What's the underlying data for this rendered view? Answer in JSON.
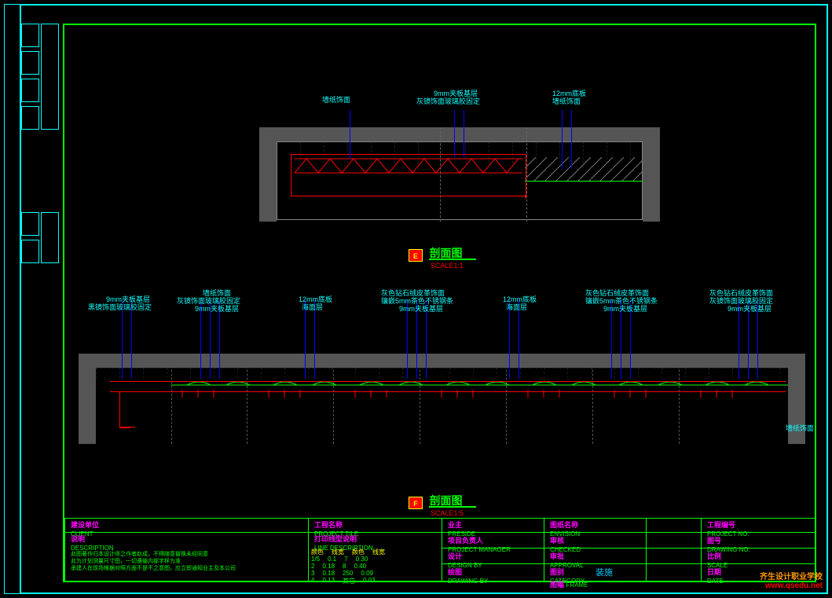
{
  "sectionE": {
    "marker": "E",
    "title": "剖面图",
    "scale": "SCALE1:1",
    "annotations": {
      "a1": "墙纸饰面",
      "a2_line1": "9mm夹板基层",
      "a2_line2": "灰镜饰面玻璃胶固定",
      "a3_line1": "12mm底板",
      "a3_line2": "墙纸饰面"
    }
  },
  "sectionF": {
    "marker": "F",
    "title": "剖面图",
    "scale": "SCALE1:5",
    "sideAnno": "墙纸饰面",
    "columns": [
      {
        "top1": "9mm夹板基层",
        "top2": "黑镜饰面玻璃胶固定"
      },
      {
        "top1": "墙纸饰面",
        "top2": "灰镜饰面玻璃胶固定",
        "top3": "9mm夹板基层"
      },
      {
        "top1": "12mm底板",
        "top2": "海面层"
      },
      {
        "top1": "灰色钻石绒皮革饰面",
        "top2": "镶嵌5mm茶色不锈钢条",
        "top3": "9mm夹板基层"
      },
      {
        "top1": "12mm底板",
        "top2": "海面层"
      },
      {
        "top1": "灰色钻石绒皮革饰面",
        "top2": "镶嵌5mm茶色不锈钢条",
        "top3": "9mm夹板基层"
      },
      {
        "top1": "灰色钻石绒皮革饰面",
        "top2": "灰镜饰面玻璃胶固定",
        "top3": "9mm夹板基层"
      }
    ]
  },
  "titleblock": {
    "client_label": "建设单位",
    "client_sub": "CLIENT",
    "desc_label": "说明",
    "desc_sub": "DESCRIPTION",
    "desc_text1": "此图著作归本设计师之作者赵成，不得随意替换未经同意",
    "desc_text2": "此为计划测量尺寸图，一切遵循内部字样为准",
    "desc_text3": "承建人在现场根据对照方面不是不之意图，应立即通知业主及本公司",
    "project_label": "工程名称",
    "project_sub": "PROJECT TILE",
    "line_label": "打印线型说明",
    "line_sub": "LINE DESCRIPTION",
    "line_head_col": "颜色",
    "line_head_wide": "线宽",
    "line_head_col2": "颜色",
    "line_head_wide2": "线宽",
    "line_rows": [
      {
        "c1": "1/5",
        "w1": "0.1",
        "c2": "7",
        "w2": "0.30"
      },
      {
        "c1": "2",
        "w1": "0.18",
        "c2": "8",
        "w2": "0.40"
      },
      {
        "c1": "3",
        "w1": "0.18",
        "c2": "250",
        "w2": "0.09"
      },
      {
        "c1": "4",
        "w1": "0.13",
        "c2": "其它",
        "w2": "0.03"
      }
    ],
    "owner_label": "业主",
    "owner_sub": "PRESIDE",
    "pm_label": "项目负责人",
    "pm_sub": "PROJECT MANAGER",
    "design_label": "设计",
    "design_sub": "DESIGN BY",
    "drawing_label": "绘图",
    "drawing_sub": "DRAWING BY",
    "approve_label": "审批",
    "approve_sub": "APPROVAL",
    "check_label": "审核",
    "check_sub": "CHECKED",
    "category_label": "图别",
    "category_sub": "CATEGORY",
    "category_val": "装施",
    "frame_label": "图幅",
    "frame_sub": "FRAME",
    "sheetname_label": "图纸名称",
    "sheetname_sub": "ENVISION",
    "projno_label": "工程编号",
    "projno_sub": "PROJECT NO.",
    "scale_label": "比例",
    "scale_sub": "SCALE",
    "sheetno_label": "图号",
    "sheetno_sub": "DRAWING NO.",
    "date_label": "日期",
    "date_sub": "DATE"
  },
  "watermark": {
    "line1": "齐生设计职业学校",
    "line2": "www.qsedu.net"
  }
}
